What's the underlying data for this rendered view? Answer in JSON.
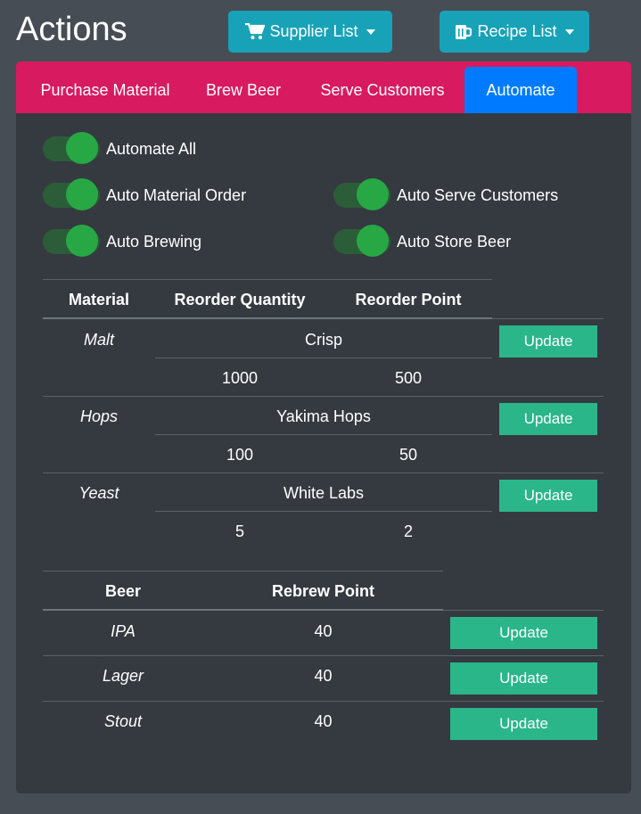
{
  "header": {
    "title": "Actions",
    "supplier_button": "Supplier List",
    "recipe_button": "Recipe List"
  },
  "tabs": [
    {
      "label": "Purchase Material",
      "active": false
    },
    {
      "label": "Brew Beer",
      "active": false
    },
    {
      "label": "Serve Customers",
      "active": false
    },
    {
      "label": "Automate",
      "active": true
    }
  ],
  "toggles": {
    "automate_all": {
      "label": "Automate All",
      "on": true
    },
    "auto_material_order": {
      "label": "Auto Material Order",
      "on": true
    },
    "auto_serve_customers": {
      "label": "Auto Serve Customers",
      "on": true
    },
    "auto_brewing": {
      "label": "Auto Brewing",
      "on": true
    },
    "auto_store_beer": {
      "label": "Auto Store Beer",
      "on": true
    }
  },
  "materials_table": {
    "headers": [
      "Material",
      "Reorder Quantity",
      "Reorder Point"
    ],
    "rows": [
      {
        "material": "Malt",
        "supplier": "Crisp",
        "reorder_quantity": "1000",
        "reorder_point": "500",
        "button": "Update"
      },
      {
        "material": "Hops",
        "supplier": "Yakima Hops",
        "reorder_quantity": "100",
        "reorder_point": "50",
        "button": "Update"
      },
      {
        "material": "Yeast",
        "supplier": "White Labs",
        "reorder_quantity": "5",
        "reorder_point": "2",
        "button": "Update"
      }
    ]
  },
  "beer_table": {
    "headers": [
      "Beer",
      "Rebrew Point"
    ],
    "rows": [
      {
        "beer": "IPA",
        "rebrew_point": "40",
        "button": "Update"
      },
      {
        "beer": "Lager",
        "rebrew_point": "40",
        "button": "Update"
      },
      {
        "beer": "Stout",
        "rebrew_point": "40",
        "button": "Update"
      }
    ]
  },
  "colors": {
    "tab_bar": "#d81b60",
    "active_tab": "#007bff",
    "dropdown_button": "#17a2b8",
    "toggle_on": "#28a745",
    "update_button": "#2bb68a",
    "card": "#343a40",
    "page": "#474d54"
  }
}
